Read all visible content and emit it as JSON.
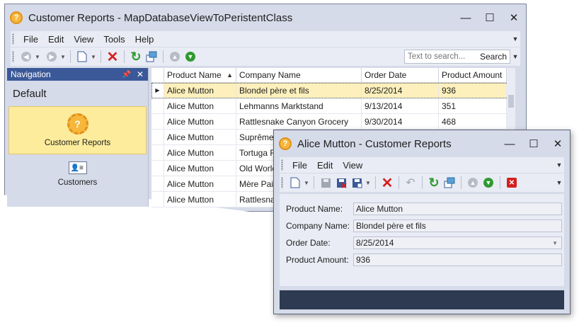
{
  "main_window": {
    "title": "Customer Reports - MapDatabaseViewToPeristentClass",
    "controls": {
      "minimize": "—",
      "maximize": "☐",
      "close": "✕"
    },
    "menu": [
      "File",
      "Edit",
      "View",
      "Tools",
      "Help"
    ],
    "toolbar": {
      "icons": [
        "back-icon",
        "forward-icon",
        "new-icon",
        "delete-icon",
        "refresh-icon",
        "save-and-new-icon",
        "previous-record-icon",
        "next-record-icon"
      ],
      "search_placeholder": "Text to search...",
      "search_button": "Search"
    },
    "navigation": {
      "header": "Navigation",
      "group": "Default",
      "items": [
        {
          "label": "Customer Reports",
          "selected": true,
          "icon": "customer-reports-icon"
        },
        {
          "label": "Customers",
          "selected": false,
          "icon": "customers-icon"
        }
      ]
    },
    "grid": {
      "columns": [
        "Product Name",
        "Company Name",
        "Order Date",
        "Product Amount"
      ],
      "sorted_column": "Product Name",
      "rows": [
        [
          "Alice Mutton",
          "Blondel père et fils",
          "8/25/2014",
          "936"
        ],
        [
          "Alice Mutton",
          "Lehmanns Marktstand",
          "9/13/2014",
          "351"
        ],
        [
          "Alice Mutton",
          "Rattlesnake Canyon Grocery",
          "9/30/2014",
          "468"
        ],
        [
          "Alice Mutton",
          "Suprêmes",
          "",
          ""
        ],
        [
          "Alice Mutton",
          "Tortuga R",
          "",
          ""
        ],
        [
          "Alice Mutton",
          "Old World",
          "",
          ""
        ],
        [
          "Alice Mutton",
          "Mère Pailla",
          "",
          ""
        ],
        [
          "Alice Mutton",
          "Rattlesna",
          "",
          ""
        ]
      ],
      "selected_row": 0
    }
  },
  "detail_window": {
    "title": "Alice Mutton - Customer Reports",
    "controls": {
      "minimize": "—",
      "maximize": "☐",
      "close": "✕"
    },
    "menu": [
      "File",
      "Edit",
      "View"
    ],
    "toolbar_icons": [
      "new-icon",
      "save-icon",
      "save-and-close-icon",
      "save-and-new-icon",
      "delete-icon",
      "undo-icon",
      "refresh-icon",
      "save-as-icon",
      "previous-record-icon",
      "next-record-icon",
      "close-record-icon"
    ],
    "fields": [
      {
        "label": "Product Name:",
        "value": "Alice Mutton"
      },
      {
        "label": "Company Name:",
        "value": "Blondel père et fils"
      },
      {
        "label": "Order Date:",
        "value": "8/25/2014"
      },
      {
        "label": "Product Amount:",
        "value": "936"
      }
    ]
  },
  "colors": {
    "window_bg": "#d6dbe9",
    "nav_header": "#3b5998",
    "selection": "#fcec9c",
    "status_bar": "#2e3a52",
    "delete_red": "#d42020",
    "refresh_green": "#2f9a2f"
  }
}
